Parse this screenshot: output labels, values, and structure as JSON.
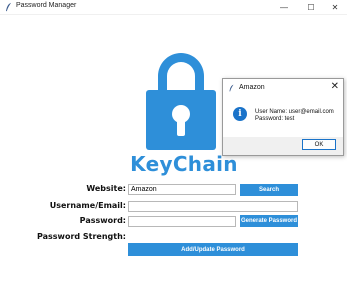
{
  "window": {
    "title": "Password Manager",
    "minimize_glyph": "—",
    "maximize_glyph": "☐",
    "close_glyph": "✕"
  },
  "brand": {
    "name": "KeyChain",
    "logo_icon": "padlock-icon",
    "color": "#2e8fd9"
  },
  "form": {
    "website_label": "Website:",
    "website_value": "Amazon",
    "username_label": "Username/Email:",
    "username_value": "",
    "password_label": "Password:",
    "password_value": "",
    "strength_label": "Password Strength:",
    "search_button": "Search",
    "generate_button": "Generate Password",
    "add_update_button": "Add/Update Password",
    "button_color": "#2e8fd9"
  },
  "dialog": {
    "title": "Amazon",
    "icon": "info-icon",
    "close_glyph": "✕",
    "line1": "User Name: user@email.com",
    "line2": "Password: test",
    "ok_label": "OK"
  }
}
